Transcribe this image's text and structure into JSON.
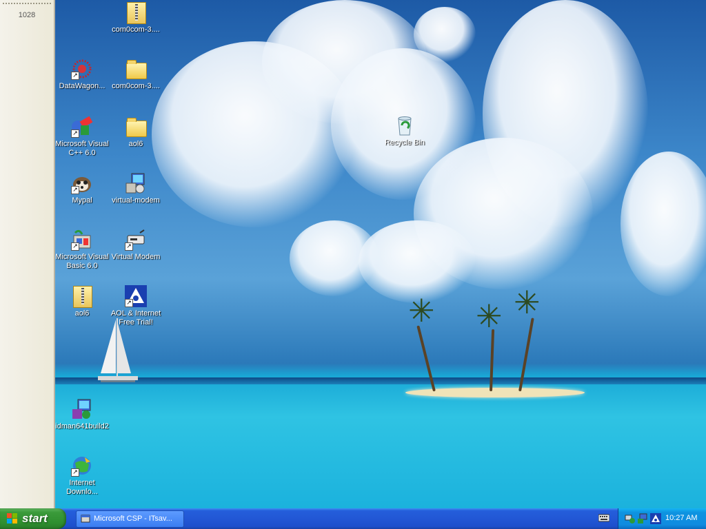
{
  "left_panel": {
    "number": "1028"
  },
  "desktop": {
    "icons": [
      {
        "label": "com0com-3...."
      },
      {
        "label": "DataWagon..."
      },
      {
        "label": "com0com-3...."
      },
      {
        "label": "Microsoft Visual C++ 6.0"
      },
      {
        "label": "aol6"
      },
      {
        "label": "Mypal"
      },
      {
        "label": "virtual-modem"
      },
      {
        "label": "Microsoft Visual Basic 6.0"
      },
      {
        "label": "Virtual Modem"
      },
      {
        "label": "aol6"
      },
      {
        "label": "AOL & Internet Free Trial!"
      },
      {
        "label": "idman641build2"
      },
      {
        "label": "Internet Downlo..."
      },
      {
        "label": "Recycle Bin"
      }
    ]
  },
  "taskbar": {
    "start_label": "start",
    "task_item_label": "Microsoft CSP - ITsav...",
    "clock": "10:27 AM"
  },
  "colors": {
    "taskbar_blue": "#245edb",
    "start_green": "#3a9a3a",
    "tray_blue": "#0f8be0"
  }
}
